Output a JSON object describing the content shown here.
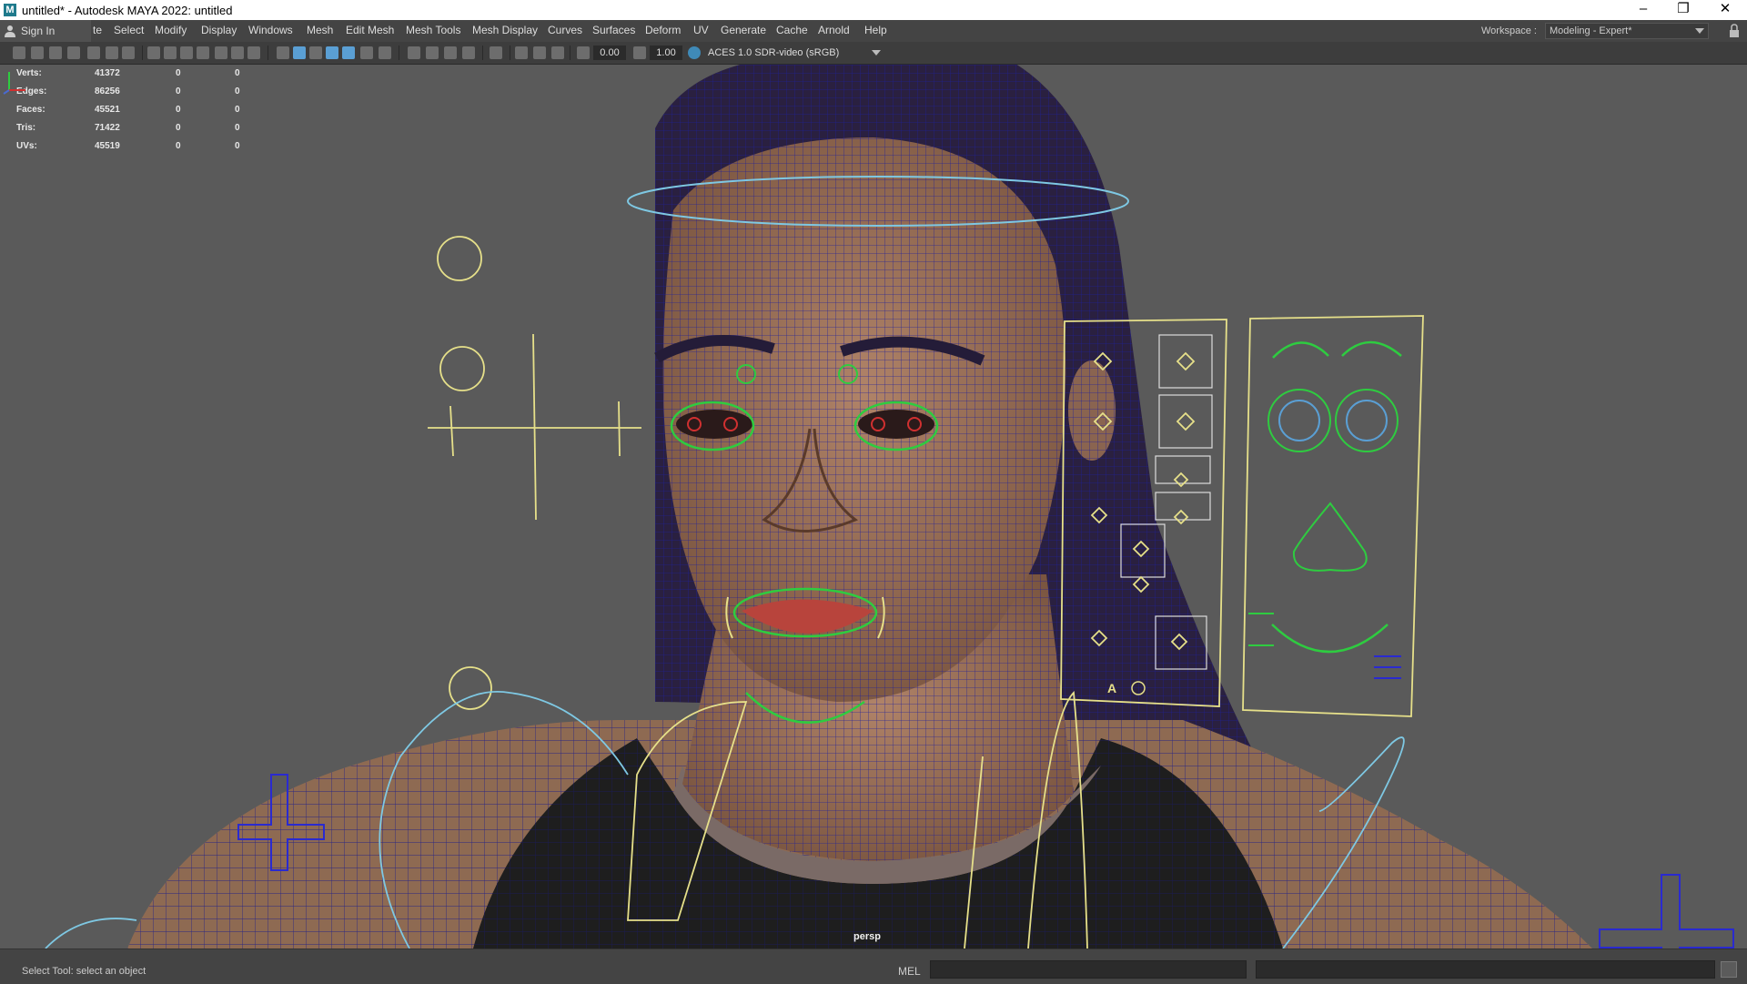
{
  "window": {
    "title": "untitled* - Autodesk MAYA 2022: untitled",
    "app_icon": "M",
    "controls": [
      "minimize-icon",
      "restore-icon",
      "close-icon"
    ]
  },
  "menubar": {
    "signin_label": "Sign In",
    "items": [
      "te",
      "Select",
      "Modify",
      "Display",
      "Windows",
      "Mesh",
      "Edit Mesh",
      "Mesh Tools",
      "Mesh Display",
      "Curves",
      "Surfaces",
      "Deform",
      "UV",
      "Generate",
      "Cache",
      "Arnold",
      "Help"
    ],
    "workspace_label": "Workspace :",
    "workspace_value": "Modeling - Expert*"
  },
  "toolbar": {
    "exposure": "0.00",
    "gamma": "1.00",
    "color_space": "ACES 1.0 SDR-video (sRGB)"
  },
  "hud": {
    "rows": [
      {
        "label": "Verts:",
        "v1": "41372",
        "v2": "0",
        "v3": "0"
      },
      {
        "label": "Edges:",
        "v1": "86256",
        "v2": "0",
        "v3": "0"
      },
      {
        "label": "Faces:",
        "v1": "45521",
        "v2": "0",
        "v3": "0"
      },
      {
        "label": "Tris:",
        "v1": "71422",
        "v2": "0",
        "v3": "0"
      },
      {
        "label": "UVs:",
        "v1": "45519",
        "v2": "0",
        "v3": "0"
      }
    ]
  },
  "viewport": {
    "camera_label": "persp",
    "facial_panel_letter": "A",
    "colors": {
      "background": "#5a5a5a",
      "wire_blue": "#1a1a8c",
      "ctrl_yellow": "#e6e08a",
      "ctrl_green": "#2ecc40",
      "ctrl_cyan": "#7ec8e3",
      "skin": "#9a7158",
      "shirt": "#1e1e1e"
    }
  },
  "helpline": {
    "text": "Select Tool: select an object",
    "command_language": "MEL"
  }
}
